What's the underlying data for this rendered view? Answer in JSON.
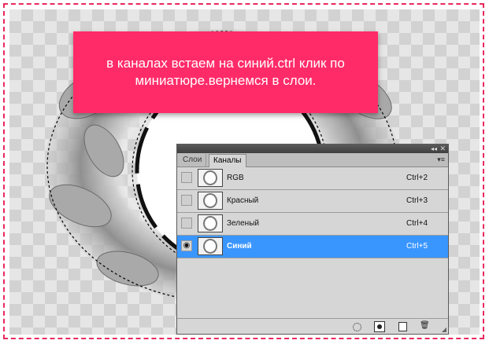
{
  "banner": {
    "text": "в каналах встаем на синий.ctrl клик по\nминиатюре.вернемся в слои."
  },
  "panel": {
    "tabs": [
      {
        "label": "Слои",
        "active": false
      },
      {
        "label": "Каналы",
        "active": true
      }
    ],
    "channels": [
      {
        "name": "RGB",
        "shortcut": "Ctrl+2",
        "visible": false,
        "selected": false
      },
      {
        "name": "Красный",
        "shortcut": "Ctrl+3",
        "visible": false,
        "selected": false
      },
      {
        "name": "Зеленый",
        "shortcut": "Ctrl+4",
        "visible": false,
        "selected": false
      },
      {
        "name": "Синий",
        "shortcut": "Ctrl+5",
        "visible": true,
        "selected": true
      }
    ],
    "titlebar_icons": {
      "collapse": "double-chevron-right-icon",
      "close": "close-icon"
    },
    "bottom_icons": [
      "load-selection-icon",
      "save-selection-icon",
      "new-channel-icon",
      "trash-icon"
    ]
  },
  "colors": {
    "accent": "#ff2b68",
    "frame_border": "#e8295e",
    "selection": "#3a96ff"
  }
}
